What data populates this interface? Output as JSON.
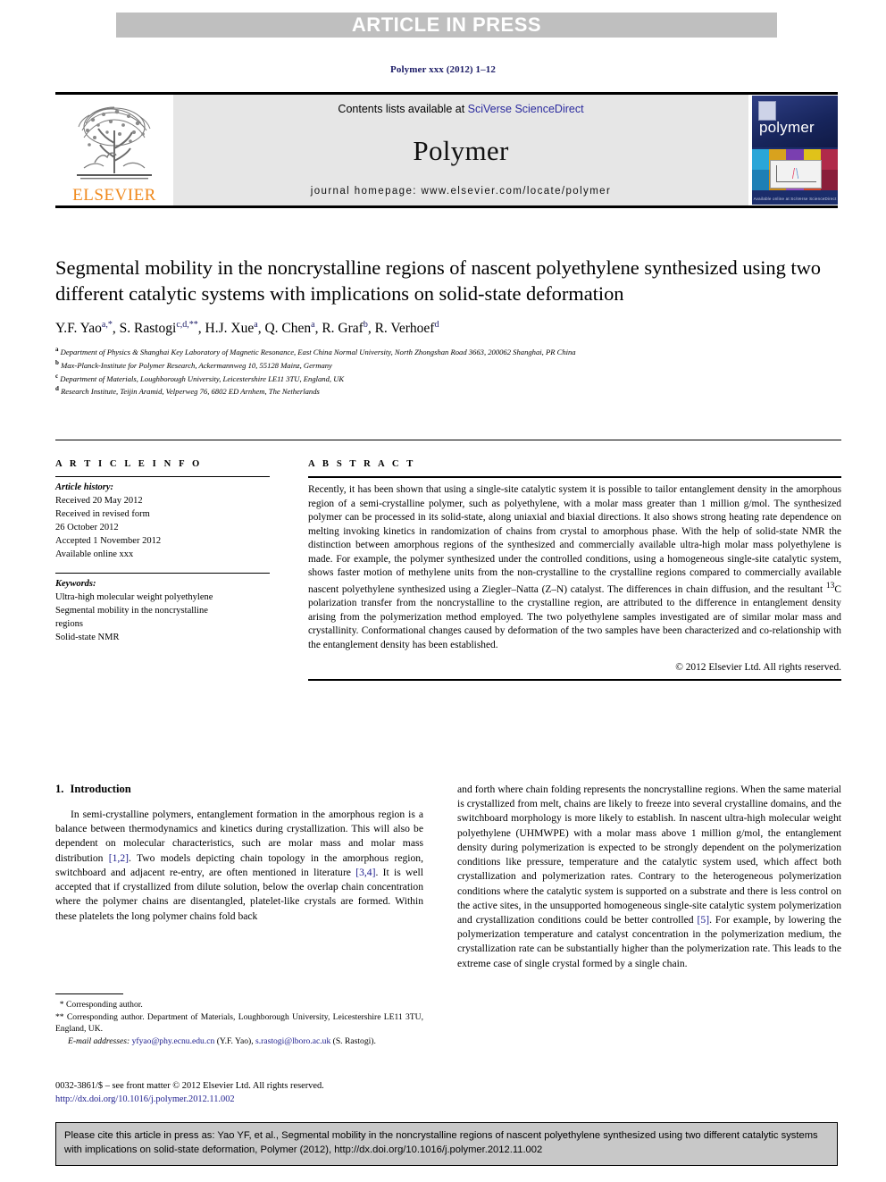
{
  "banner": {
    "text": "ARTICLE IN PRESS"
  },
  "journal_ref": "Polymer xxx (2012) 1–12",
  "masthead": {
    "publisher_logo_label": "ELSEVIER",
    "contents_prefix": "Contents lists available at ",
    "contents_link": "SciVerse ScienceDirect",
    "journal_name": "Polymer",
    "homepage_line": "journal homepage: www.elsevier.com/locate/polymer",
    "cover_title": "polymer",
    "cover_footer": "Available online at\nSciVerse ScienceDirect"
  },
  "article": {
    "title": "Segmental mobility in the noncrystalline regions of nascent polyethylene synthesized using two different catalytic systems with implications on solid-state deformation",
    "authors_html": "Y.F. Yao<sup>a,*</sup>, S. Rastogi<sup>c,d,**</sup>, H.J. Xue<sup>a</sup>, Q. Chen<sup>a</sup>, R. Graf<sup>b</sup>, R. Verhoef<sup>d</sup>",
    "affiliations": [
      {
        "marker": "a",
        "text": "Department of Physics & Shanghai Key Laboratory of Magnetic Resonance, East China Normal University, North Zhongshan Road 3663, 200062 Shanghai, PR China"
      },
      {
        "marker": "b",
        "text": "Max-Planck-Institute for Polymer Research, Ackermannweg 10, 55128 Mainz, Germany"
      },
      {
        "marker": "c",
        "text": "Department of Materials, Loughborough University, Leicestershire LE11 3TU, England, UK"
      },
      {
        "marker": "d",
        "text": "Research Institute, Teijin Aramid, Velperweg 76, 6802 ED Arnhem, The Netherlands"
      }
    ]
  },
  "article_info": {
    "heading": "A R T I C L E   I N F O",
    "history_label": "Article history:",
    "history_lines": [
      "Received 20 May 2012",
      "Received in revised form",
      "26 October 2012",
      "Accepted 1 November 2012",
      "Available online xxx"
    ],
    "keywords_label": "Keywords:",
    "keywords": [
      "Ultra-high molecular weight polyethylene",
      "Segmental mobility in the noncrystalline",
      "regions",
      "Solid-state NMR"
    ]
  },
  "abstract": {
    "heading": "A B S T R A C T",
    "body": "Recently, it has been shown that using a single-site catalytic system it is possible to tailor entanglement density in the amorphous region of a semi-crystalline polymer, such as polyethylene, with a molar mass greater than 1 million g/mol. The synthesized polymer can be processed in its solid-state, along uniaxial and biaxial directions. It also shows strong heating rate dependence on melting invoking kinetics in randomization of chains from crystal to amorphous phase. With the help of solid-state NMR the distinction between amorphous regions of the synthesized and commercially available ultra-high molar mass polyethylene is made. For example, the polymer synthesized under the controlled conditions, using a homogeneous single-site catalytic system, shows faster motion of methylene units from the non-crystalline to the crystalline regions compared to commercially available nascent polyethylene synthesized using a Ziegler–Natta (Z–N) catalyst. The differences in chain diffusion, and the resultant ",
    "superscript_13": "13",
    "body_cont": "C polarization transfer from the noncrystalline to the crystalline region, are attributed to the difference in entanglement density arising from the polymerization method employed. The two polyethylene samples investigated are of similar molar mass and crystallinity. Conformational changes caused by deformation of the two samples have been characterized and co-relationship with the entanglement density has been established.",
    "copyright": "© 2012 Elsevier Ltd. All rights reserved."
  },
  "introduction": {
    "number": "1.",
    "heading": "Introduction",
    "left_paragraph_part1": "In semi-crystalline polymers, entanglement formation in the amorphous region is a balance between thermodynamics and kinetics during crystallization. This will also be dependent on molecular characteristics, such are molar mass and molar mass distribution ",
    "ref_1_2": "[1,2]",
    "left_paragraph_part2": ". Two models depicting chain topology in the amorphous region, switchboard and adjacent re-entry, are often mentioned in literature ",
    "ref_3_4": "[3,4]",
    "left_paragraph_part3": ". It is well accepted that if crystallized from dilute solution, below the overlap chain concentration where the polymer chains are disentangled, platelet-like crystals are formed. Within these platelets the long polymer chains fold back",
    "right_paragraph_part1": "and forth where chain folding represents the noncrystalline regions. When the same material is crystallized from melt, chains are likely to freeze into several crystalline domains, and the switchboard morphology is more likely to establish. In nascent ultra-high molecular weight polyethylene (UHMWPE) with a molar mass above 1 million g/mol, the entanglement density during polymerization is expected to be strongly dependent on the polymerization conditions like pressure, temperature and the catalytic system used, which affect both crystallization and polymerization rates. Contrary to the heterogeneous polymerization conditions where the catalytic system is supported on a substrate and there is less control on the active sites, in the unsupported homogeneous single-site catalytic system polymerization and crystallization conditions could be better controlled ",
    "ref_5": "[5]",
    "right_paragraph_part2": ". For example, by lowering the polymerization temperature and catalyst concentration in the polymerization medium, the crystallization rate can be substantially higher than the polymerization rate. This leads to the extreme case of single crystal formed by a single chain."
  },
  "footnotes": {
    "corr1_marker": "*",
    "corr1": "Corresponding author.",
    "corr2_marker": "**",
    "corr2": "Corresponding author. Department of Materials, Loughborough University, Leicestershire LE11 3TU, England, UK.",
    "email_label": "E-mail addresses:",
    "email1": "yfyao@phy.ecnu.edu.cn",
    "email1_owner": "(Y.F. Yao)",
    "email2": "s.rastogi@lboro.ac.uk",
    "email2_owner": "(S. Rastogi)."
  },
  "issn": {
    "line1": "0032-3861/$ – see front matter © 2012 Elsevier Ltd. All rights reserved.",
    "doi": "http://dx.doi.org/10.1016/j.polymer.2012.11.002"
  },
  "cite_box": {
    "text": "Please cite this article in press as: Yao YF, et al., Segmental mobility in the noncrystalline regions of nascent polyethylene synthesized using two different catalytic systems with implications on solid-state deformation, Polymer (2012), http://dx.doi.org/10.1016/j.polymer.2012.11.002"
  },
  "colors": {
    "banner_bg": "#bfbfbf",
    "masthead_bg": "#e6e6e6",
    "link_blue": "#2b2b9e",
    "ref_blue": "#1b1b8c",
    "navy": "#1b1b66",
    "elsevier_orange": "#f08a1e",
    "cover_blue": "#1b2d6b",
    "cite_bg": "#c8c8c8"
  }
}
